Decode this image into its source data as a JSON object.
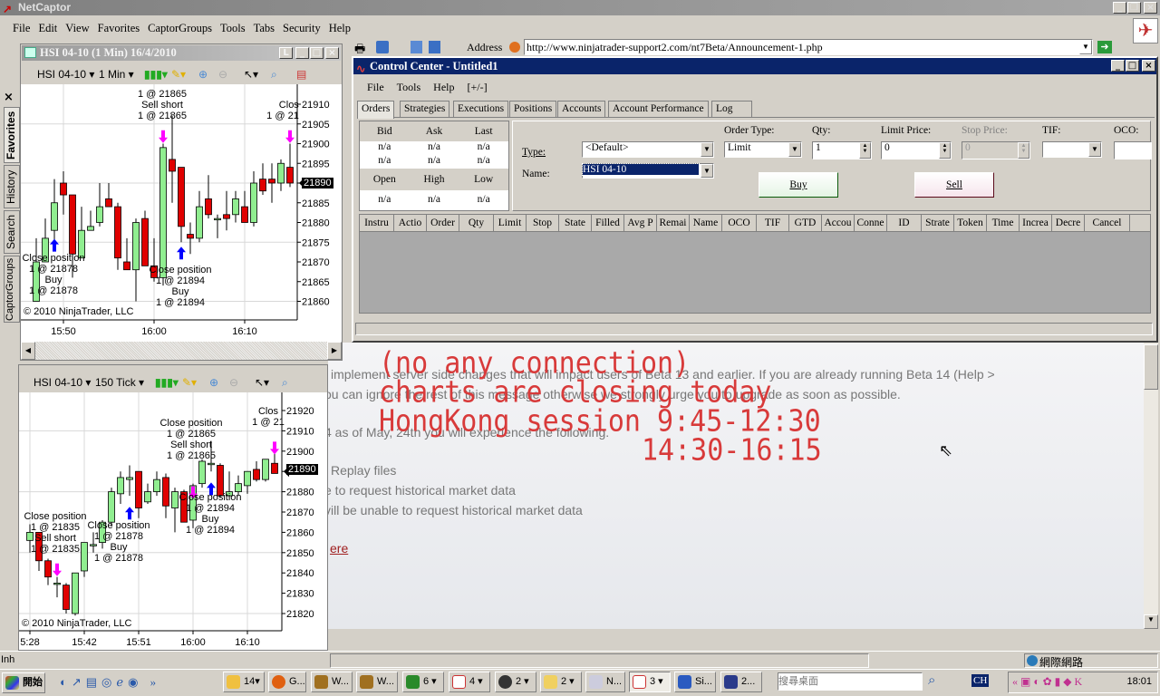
{
  "browser": {
    "title": "NetCaptor",
    "menu": [
      "File",
      "Edit",
      "View",
      "Favorites",
      "CaptorGroups",
      "Tools",
      "Tabs",
      "Security",
      "Help"
    ],
    "address_label": "Address",
    "url": "http://www.ninjatrader-support2.com/nt7Beta/Announcement-1.php",
    "sidebar_tabs": [
      "Favorites",
      "History",
      "Search",
      "CaptorGroups"
    ],
    "status_zone": "網際網路",
    "status_left": "Inh"
  },
  "web": {
    "lines": [
      "implement server side changes that will impact users of Beta 13 and earlier. If you are already running Beta 14 (Help >",
      "ou can ignore the rest of this message otherwise we strongly urge you to upgrade as soon as possible.",
      "4 as of May, 24th you will experience the following.",
      "Replay files",
      "e to request historical market data",
      "vill be unable to request historical market data"
    ],
    "link": "ere"
  },
  "overlay": {
    "lines": [
      "(no any connection)",
      "charts are closing today",
      "HongKong session 9:45-12:30",
      "14:30-16:15"
    ],
    "color": "#d83a3a"
  },
  "control_center": {
    "title": "Control Center - Untitled1",
    "menu": [
      "File",
      "Tools",
      "Help",
      "[+/-]"
    ],
    "tabs": [
      "Orders",
      "Strategies",
      "Executions",
      "Positions",
      "Accounts",
      "Account Performance",
      "Log"
    ],
    "active_tab": "Orders",
    "quote": {
      "headers1": [
        "Bid",
        "Ask",
        "Last"
      ],
      "row1": [
        "n/a",
        "n/a",
        "n/a"
      ],
      "row2": [
        "n/a",
        "n/a",
        "n/a"
      ],
      "headers2": [
        "Open",
        "High",
        "Low"
      ],
      "row3": [
        "n/a",
        "n/a",
        "n/a"
      ]
    },
    "type_label": "Type:",
    "type_value": "<Default>",
    "name_label": "Name:",
    "name_value": "HSI 04-10",
    "order_type_label": "Order Type:",
    "order_type_value": "Limit",
    "qty_label": "Qty:",
    "qty_value": "1",
    "limit_label": "Limit Price:",
    "limit_value": "0",
    "stop_label": "Stop Price:",
    "stop_value": "0",
    "tif_label": "TIF:",
    "tif_value": "",
    "oco_label": "OCO:",
    "oco_value": "",
    "buy": "Buy",
    "sell": "Sell",
    "columns": [
      "Instru",
      "Actio",
      "Order",
      "Qty",
      "Limit",
      "Stop",
      "State",
      "Filled",
      "Avg P",
      "Remai",
      "Name",
      "OCO",
      "TIF",
      "GTD",
      "Accou",
      "Conne",
      "ID",
      "Strate",
      "Token",
      "Time",
      "Increa",
      "Decre",
      "Cancel"
    ]
  },
  "chart1": {
    "title": "HSI 04-10 (1 Min)  16/4/2010",
    "instrument": "HSI 04-10",
    "interval": "1 Min",
    "copyright": "© 2010 NinjaTrader, LLC",
    "last_price": "21890",
    "annotations": [
      [
        "1 @ 21865",
        "Sell short",
        "1 @ 21865"
      ],
      [
        "Clos",
        "1 @ 21"
      ],
      [
        "Close position",
        "1 @ 21878",
        "Buy",
        "1 @ 21878"
      ],
      [
        "Close position",
        "1 @ 21894",
        "Buy",
        "1 @ 21894"
      ]
    ]
  },
  "chart2": {
    "instrument": "HSI 04-10",
    "interval": "150 Tick",
    "copyright": "© 2010 NinjaTrader, LLC",
    "last_price": "21890",
    "annotations": [
      [
        "Close position",
        "1 @ 21865",
        "Sell short",
        "1 @ 21865"
      ],
      [
        "Clos",
        "1 @ 21"
      ],
      [
        "Close position",
        "1 @ 21835",
        "Sell short",
        "1 @ 21835"
      ],
      [
        "Close position",
        "1 @ 21878",
        "Buy",
        "1 @ 21878"
      ],
      [
        "Close position",
        "1 @ 21894",
        "Buy",
        "1 @ 21894"
      ]
    ]
  },
  "chart_data": [
    {
      "type": "candlestick",
      "title": "HSI 04-10 (1 Min)",
      "x_ticks": [
        "15:50",
        "16:00",
        "16:10"
      ],
      "x_tick_bars": [
        3,
        13,
        23
      ],
      "ylim": [
        21857,
        21913
      ],
      "y_ticks": [
        21860,
        21865,
        21870,
        21875,
        21880,
        21885,
        21890,
        21895,
        21900,
        21905,
        21910
      ],
      "ohlc": [
        [
          21860,
          21876,
          21860,
          21870
        ],
        [
          21870,
          21881,
          21870,
          21876
        ],
        [
          21878,
          21891,
          21873,
          21885
        ],
        [
          21890,
          21893,
          21882,
          21887
        ],
        [
          21887,
          21887,
          21866,
          21872
        ],
        [
          21871,
          21884,
          21871,
          21878
        ],
        [
          21878,
          21883,
          21878,
          21879
        ],
        [
          21880,
          21890,
          21879,
          21884
        ],
        [
          21886,
          21890,
          21884,
          21884
        ],
        [
          21884,
          21885,
          21868,
          21871
        ],
        [
          21870,
          21876,
          21868,
          21868
        ],
        [
          21868,
          21881,
          21860,
          21880
        ],
        [
          21881,
          21883,
          21869,
          21869
        ],
        [
          21869,
          21876,
          21865,
          21866
        ],
        [
          21866,
          21900,
          21864,
          21899
        ],
        [
          21896,
          21907,
          21885,
          21893
        ],
        [
          21894,
          21894,
          21875,
          21879
        ],
        [
          21877,
          21880,
          21872,
          21876
        ],
        [
          21876,
          21888,
          21875,
          21884
        ],
        [
          21886,
          21892,
          21881,
          21882
        ],
        [
          21881,
          21882,
          21876,
          21881
        ],
        [
          21882,
          21888,
          21878,
          21881
        ],
        [
          21882,
          21888,
          21880,
          21886
        ],
        [
          21884,
          21888,
          21880,
          21880
        ],
        [
          21880,
          21893,
          21879,
          21890
        ],
        [
          21891,
          21895,
          21887,
          21888
        ],
        [
          21891,
          21895,
          21885,
          21890
        ],
        [
          21890,
          21896,
          21888,
          21895
        ],
        [
          21894,
          21900,
          21889,
          21890
        ]
      ],
      "markers": [
        {
          "bar": 2,
          "price": 21874,
          "type": "buy"
        },
        {
          "bar": 14,
          "price": 21902,
          "type": "sell"
        },
        {
          "bar": 16,
          "price": 21872,
          "type": "buy"
        },
        {
          "bar": 28,
          "price": 21902,
          "type": "sell"
        }
      ]
    },
    {
      "type": "candlestick",
      "title": "HSI 04-10 (150 Tick)",
      "x_ticks": [
        "5:28",
        "15:42",
        "15:51",
        "16:00",
        "16:10"
      ],
      "x_tick_bars": [
        0,
        6,
        12,
        18,
        24
      ],
      "ylim": [
        21815,
        21925
      ],
      "y_ticks": [
        21820,
        21830,
        21840,
        21850,
        21860,
        21870,
        21880,
        21890,
        21900,
        21910,
        21920
      ],
      "ohlc": [
        [
          21856,
          21864,
          21850,
          21860
        ],
        [
          21860,
          21860,
          21841,
          21846
        ],
        [
          21846,
          21847,
          21834,
          21838
        ],
        [
          21835,
          21838,
          21828,
          21835
        ],
        [
          21834,
          21835,
          21820,
          21822
        ],
        [
          21820,
          21840,
          21819,
          21840
        ],
        [
          21841,
          21855,
          21838,
          21855
        ],
        [
          21854,
          21860,
          21850,
          21854
        ],
        [
          21855,
          21866,
          21852,
          21865
        ],
        [
          21865,
          21882,
          21863,
          21880
        ],
        [
          21879,
          21890,
          21874,
          21887
        ],
        [
          21886,
          21893,
          21878,
          21887
        ],
        [
          21890,
          21890,
          21867,
          21872
        ],
        [
          21875,
          21884,
          21874,
          21880
        ],
        [
          21880,
          21890,
          21878,
          21886
        ],
        [
          21887,
          21889,
          21867,
          21873
        ],
        [
          21872,
          21882,
          21860,
          21880
        ],
        [
          21880,
          21881,
          21865,
          21865
        ],
        [
          21866,
          21884,
          21862,
          21883
        ],
        [
          21884,
          21896,
          21882,
          21895
        ],
        [
          21894,
          21905,
          21890,
          21894
        ],
        [
          21893,
          21894,
          21877,
          21878
        ],
        [
          21878,
          21890,
          21877,
          21880
        ],
        [
          21880,
          21888,
          21878,
          21884
        ],
        [
          21883,
          21890,
          21879,
          21890
        ],
        [
          21891,
          21895,
          21885,
          21886
        ],
        [
          21886,
          21896,
          21885,
          21896
        ],
        [
          21894,
          21900,
          21889,
          21889
        ]
      ],
      "markers": [
        {
          "bar": 3,
          "price": 21842,
          "type": "sell"
        },
        {
          "bar": 11,
          "price": 21869,
          "type": "buy"
        },
        {
          "bar": 18,
          "price": 21880,
          "type": "sell"
        },
        {
          "bar": 20,
          "price": 21881,
          "type": "buy"
        },
        {
          "bar": 27,
          "price": 21902,
          "type": "sell"
        }
      ]
    }
  ],
  "taskbar": {
    "start": "開始",
    "items": [
      "14",
      "G...",
      "W...",
      "W...",
      "6",
      "4",
      "2",
      "2",
      "N...",
      "3",
      "Si...",
      "2..."
    ],
    "search_placeholder": "搜尋桌面",
    "lang": "CH",
    "clock": "18:01"
  }
}
